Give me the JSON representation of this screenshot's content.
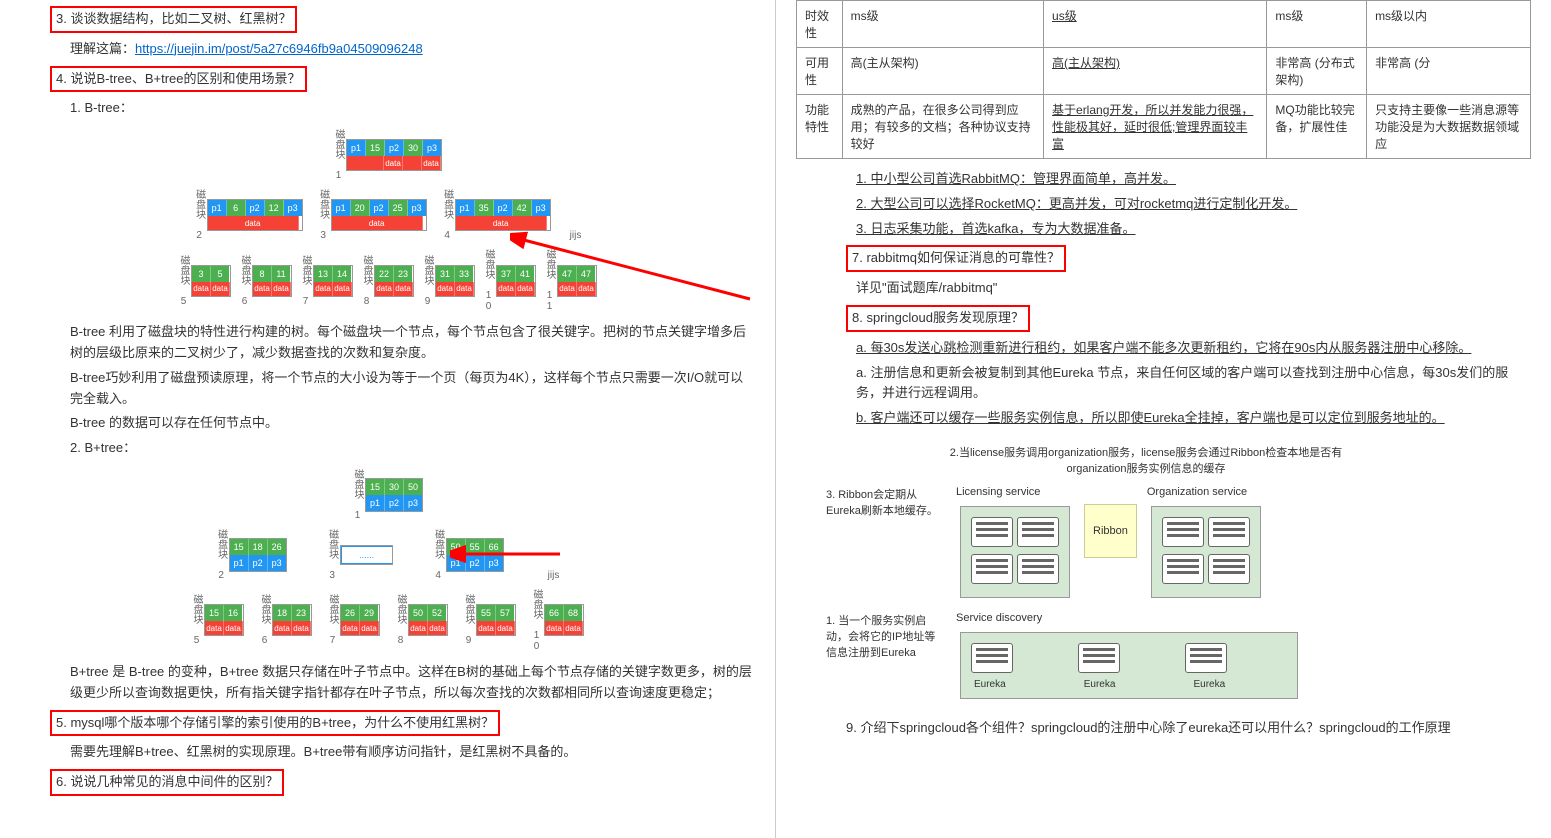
{
  "left": {
    "q3": "3. 谈谈数据结构，比如二叉树、红黑树？",
    "q3_ans": "理解这篇：",
    "q3_link": "https://juejin.im/post/5a27c6946fb9a04509096248",
    "q4": "4. 说说B-tree、B+tree的区别和使用场景？",
    "q4_1": "1. B-tree：",
    "btree_labels": [
      "磁盘块 1",
      "磁盘块 2",
      "磁盘块 3",
      "磁盘块 4",
      "磁盘块 5",
      "磁盘块 6",
      "磁盘块 7",
      "磁盘块 8",
      "磁盘块 9",
      "磁盘块 10",
      "磁盘块 11"
    ],
    "btree_root": [
      "p1",
      "15",
      "p2",
      "30",
      "p3"
    ],
    "btree_l2": [
      [
        "p1",
        "6",
        "p2",
        "12",
        "p3"
      ],
      [
        "p1",
        "20",
        "p2",
        "25",
        "p3"
      ],
      [
        "p1",
        "35",
        "p2",
        "42",
        "p3"
      ]
    ],
    "btree_l3": [
      [
        "3",
        "5"
      ],
      [
        "8",
        "11"
      ],
      [
        "13",
        "14"
      ],
      [
        "22",
        "23"
      ],
      [
        "31",
        "33"
      ],
      [
        "37",
        "41"
      ],
      [
        "47",
        "47"
      ]
    ],
    "data_label": "data",
    "jijs": "jijs",
    "btree_p1": "B-tree 利用了磁盘块的特性进行构建的树。每个磁盘块一个节点，每个节点包含了很关键字。把树的节点关键字增多后树的层级比原来的二叉树少了，减少数据查找的次数和复杂度。",
    "btree_p2": "B-tree巧妙利用了磁盘预读原理，将一个节点的大小设为等于一个页（每页为4K），这样每个节点只需要一次I/O就可以完全载入。",
    "btree_p3": "B-tree 的数据可以存在任何节点中。",
    "q4_2": "2. B+tree：",
    "bptree_root": [
      "15",
      "30",
      "50"
    ],
    "bptree_root_p": [
      "p1",
      "p2",
      "p3"
    ],
    "bptree_l2": [
      [
        "15",
        "18",
        "26"
      ],
      [
        "......"
      ],
      [
        "50",
        "55",
        "66"
      ]
    ],
    "bptree_l2_p": [
      [
        "p1",
        "p2",
        "p3"
      ],
      [],
      [
        "p1",
        "p2",
        "p3"
      ]
    ],
    "bptree_l3": [
      [
        "15",
        "16"
      ],
      [
        "18",
        "23"
      ],
      [
        "26",
        "29"
      ],
      [
        "50",
        "52"
      ],
      [
        "55",
        "57"
      ],
      [
        "66",
        "68"
      ]
    ],
    "bptree_p1": "B+tree 是 B-tree 的变种，B+tree 数据只存储在叶子节点中。这样在B树的基础上每个节点存储的关键字数更多，树的层级更少所以查询数据更快，所有指关键字指针都存在叶子节点，所以每次查找的次数都相同所以查询速度更稳定；",
    "q5": "5. mysql哪个版本哪个存储引擎的索引使用的B+tree，为什么不使用红黑树？",
    "q5_ans": "需要先理解B+tree、红黑树的实现原理。B+tree带有顺序访问指针，是红黑树不具备的。",
    "q6": "6. 说说几种常见的消息中间件的区别？"
  },
  "right": {
    "table": {
      "rows": [
        [
          "时效性",
          "ms级",
          "us级",
          "ms级",
          "ms级以内"
        ],
        [
          "可用性",
          "高(主从架构)",
          "高(主从架构)",
          "非常高 (分布式架构)",
          "非常高 (分"
        ],
        [
          "功能特性",
          "成熟的产品，在很多公司得到应用；有较多的文档；各种协议支持较好",
          "基于erlang开发，所以并发能力很强，性能极其好，延时很低;管理界面较丰富",
          "MQ功能比较完备，扩展性佳",
          "只支持主要像一些消息源等功能没是为大数据数据领域应"
        ]
      ]
    },
    "li1": "1. 中小型公司首选RabbitMQ：管理界面简单，高并发。",
    "li2": "2. 大型公司可以选择RocketMQ：更高并发，可对rocketmq进行定制化开发。",
    "li3": "3. 日志采集功能，首选kafka，专为大数据准备。",
    "q7": "7. rabbitmq如何保证消息的可靠性？",
    "q7_ans": "详见\"面试题库/rabbitmq\"",
    "q8": "8. springcloud服务发现原理？",
    "q8_a": "a. 每30s发送心跳检测重新进行租约，如果客户端不能多次更新租约，它将在90s内从服务器注册中心移除。",
    "q8_b": "a. 注册信息和更新会被复制到其他Eureka 节点，来自任何区域的客户端可以查找到注册中心信息，每30s发们的服务，并进行远程调用。",
    "q8_c": "b. 客户端还可以缓存一些服务实例信息，所以即使Eureka全挂掉，客户端也是可以定位到服务地址的。",
    "svc": {
      "step2": "2.当license服务调用organization服务，license服务会通过Ribbon检查本地是否有organization服务实例信息的缓存",
      "step3": "3. Ribbon会定期从Eureka刷新本地缓存。",
      "step1": "1. 当一个服务实例启动，会将它的IP地址等信息注册到Eureka",
      "licensing": "Licensing service",
      "organization": "Organization service",
      "ribbon": "Ribbon",
      "discovery": "Service discovery",
      "eureka": "Eureka"
    },
    "q9": "9. 介绍下springcloud各个组件？springcloud的注册中心除了eureka还可以用什么？springcloud的工作原理"
  }
}
